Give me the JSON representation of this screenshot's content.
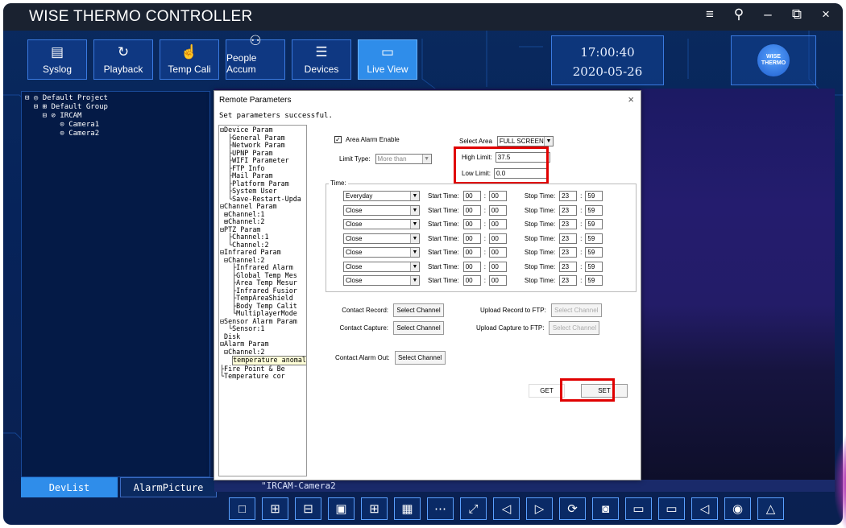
{
  "app": {
    "title": "WISE THERMO CONTROLLER"
  },
  "window_controls": [
    "≡",
    "⚲",
    "–",
    "⧉",
    "×"
  ],
  "toolbar": [
    {
      "label": "Syslog",
      "icon": "syslog-icon",
      "glyph": "▤"
    },
    {
      "label": "Playback",
      "icon": "playback-icon",
      "glyph": "↻"
    },
    {
      "label": "Temp Cali",
      "icon": "hand-pointer-icon",
      "glyph": "☝"
    },
    {
      "label": "People Accum",
      "icon": "people-icon",
      "glyph": "⚇"
    },
    {
      "label": "Devices",
      "icon": "devices-icon",
      "glyph": "☰"
    },
    {
      "label": "Live View",
      "icon": "live-view-icon",
      "glyph": "▭"
    }
  ],
  "clock": {
    "time": "17:00:40",
    "date": "2020-05-26"
  },
  "logo": {
    "text": "WISE THERMO"
  },
  "device_tree": [
    "Default Project",
    "Default Group",
    "IRCAM",
    "Camera1",
    "Camera2"
  ],
  "left_tabs": [
    "DevList",
    "AlarmPicture"
  ],
  "camera_label": "\"IRCAM-Camera2",
  "dialog": {
    "title": "Remote Parameters",
    "close": "×",
    "status": "Set parameters successful.",
    "param_tree": [
      "⊟Device Param",
      "  ├General Param",
      "  ├Network Param",
      "  ├UPNP Param",
      "  ├WIFI Parameter",
      "  ├FTP Info",
      "  ├Mail Param",
      "  ├Platform Param",
      "  ├System User",
      "  └Save-Restart-Upda",
      "⊟Channel Param",
      " ⊞Channel:1",
      " ⊞Channel:2",
      "⊟PTZ Param",
      "  ├Channel:1",
      "  └Channel:2",
      "⊟Infrared Param",
      " ⊟Channel:2",
      "   ├Infrared Alarm",
      "   ├Global Temp Mes",
      "   ├Area Temp Mesur",
      "   ├Infrared Fusior",
      "   ├TempAreaShield",
      "   ├Body Temp Calit",
      "   └MultiplayerMode",
      "⊟Sensor Alarm Param",
      "  └Sensor:1",
      " Disk",
      "⊟Alarm Param",
      " ⊟Channel:2"
    ],
    "param_tree_selected": "temperature anomaly Alarm",
    "param_tree_after": [
      "   ├Fire Point & Be",
      "   └Temperature cor"
    ],
    "area_alarm_label": "Area Alarm Enable",
    "area_alarm_check": "✓",
    "select_area_label": "Select Area",
    "select_area_value": "FULL SCREEN",
    "limit_type_label": "Limit Type:",
    "limit_type_value": "More than",
    "high_limit_label": "High Limit:",
    "high_limit_value": "37.5",
    "low_limit_label": "Low Limit:",
    "low_limit_value": "0.0",
    "time_label": "Time:",
    "schedule": [
      {
        "day": "Everyday",
        "start_h": "00",
        "start_m": "00",
        "stop_h": "23",
        "stop_m": "59"
      },
      {
        "day": "Close",
        "start_h": "00",
        "start_m": "00",
        "stop_h": "23",
        "stop_m": "59"
      },
      {
        "day": "Close",
        "start_h": "00",
        "start_m": "00",
        "stop_h": "23",
        "stop_m": "59"
      },
      {
        "day": "Close",
        "start_h": "00",
        "start_m": "00",
        "stop_h": "23",
        "stop_m": "59"
      },
      {
        "day": "Close",
        "start_h": "00",
        "start_m": "00",
        "stop_h": "23",
        "stop_m": "59"
      },
      {
        "day": "Close",
        "start_h": "00",
        "start_m": "00",
        "stop_h": "23",
        "stop_m": "59"
      },
      {
        "day": "Close",
        "start_h": "00",
        "start_m": "00",
        "stop_h": "23",
        "stop_m": "59"
      }
    ],
    "start_time_label": "Start Time:",
    "stop_time_label": "Stop Time:",
    "colon": ":",
    "contact_record_label": "Contact Record:",
    "contact_capture_label": "Contact Capture:",
    "contact_alarm_out_label": "Contact Alarm Out:",
    "select_channel": "Select Channel",
    "upload_record_label": "Upload Record to FTP:",
    "upload_capture_label": "Upload Capture to FTP:",
    "get_label": "GET",
    "set_label": "SET"
  },
  "bottom_buttons": [
    {
      "icon": "layout-1-icon",
      "glyph": "□"
    },
    {
      "icon": "layout-4-icon",
      "glyph": "⊞"
    },
    {
      "icon": "layout-6-icon",
      "glyph": "⊟"
    },
    {
      "icon": "layout-8-icon",
      "glyph": "▣"
    },
    {
      "icon": "layout-9-icon",
      "glyph": "⊞"
    },
    {
      "icon": "layout-16-icon",
      "glyph": "▦"
    },
    {
      "icon": "more-icon",
      "glyph": "⋯"
    },
    {
      "icon": "fullscreen-icon",
      "glyph": "⤢"
    },
    {
      "icon": "prev-icon",
      "glyph": "◁"
    },
    {
      "icon": "next-icon",
      "glyph": "▷"
    },
    {
      "icon": "refresh-icon",
      "glyph": "⟳"
    },
    {
      "icon": "snapshot-icon",
      "glyph": "◙"
    },
    {
      "icon": "folder-icon",
      "glyph": "▭"
    },
    {
      "icon": "record-icon",
      "glyph": "▭"
    },
    {
      "icon": "speaker-icon",
      "glyph": "◁"
    },
    {
      "icon": "talk-icon",
      "glyph": "◉"
    },
    {
      "icon": "alarm-icon",
      "glyph": "△"
    }
  ],
  "colors": {
    "accent": "#2f8dea",
    "highlight_box": "#e00000",
    "panel": "#041a46"
  }
}
